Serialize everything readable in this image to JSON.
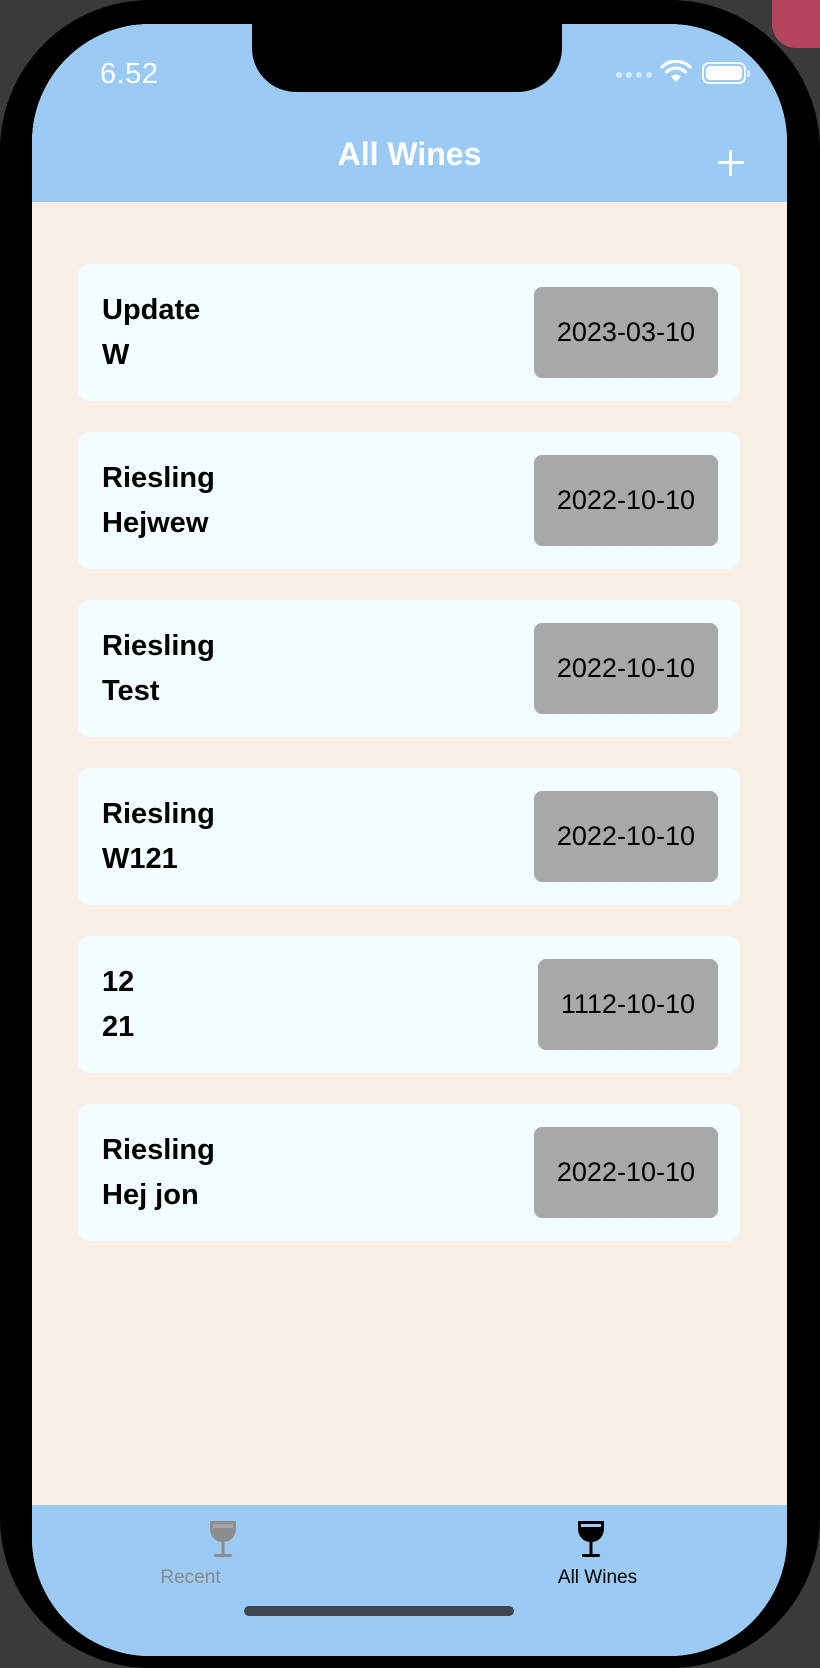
{
  "status_bar": {
    "time": "6.52"
  },
  "nav": {
    "title": "All Wines",
    "add_icon": "plus-icon"
  },
  "wines": [
    {
      "line1": "Update",
      "line2": "W",
      "date": "2023-03-10"
    },
    {
      "line1": "Riesling",
      "line2": "Hejwew",
      "date": "2022-10-10"
    },
    {
      "line1": "Riesling",
      "line2": "Test",
      "date": "2022-10-10"
    },
    {
      "line1": "Riesling",
      "line2": "W121",
      "date": "2022-10-10"
    },
    {
      "line1": "12",
      "line2": "21",
      "date": "1112-10-10"
    },
    {
      "line1": "Riesling",
      "line2": "Hej jon",
      "date": "2022-10-10"
    }
  ],
  "tabs": [
    {
      "label": "Recent",
      "icon": "wine-glass-outline-icon",
      "selected": false
    },
    {
      "label": "All Wines",
      "icon": "wine-glass-filled-icon",
      "selected": true
    }
  ],
  "colors": {
    "bar": "#9bcaf5",
    "background": "#f8f0e7",
    "card": "#f1fdff",
    "badge": "#a8a8a8"
  }
}
